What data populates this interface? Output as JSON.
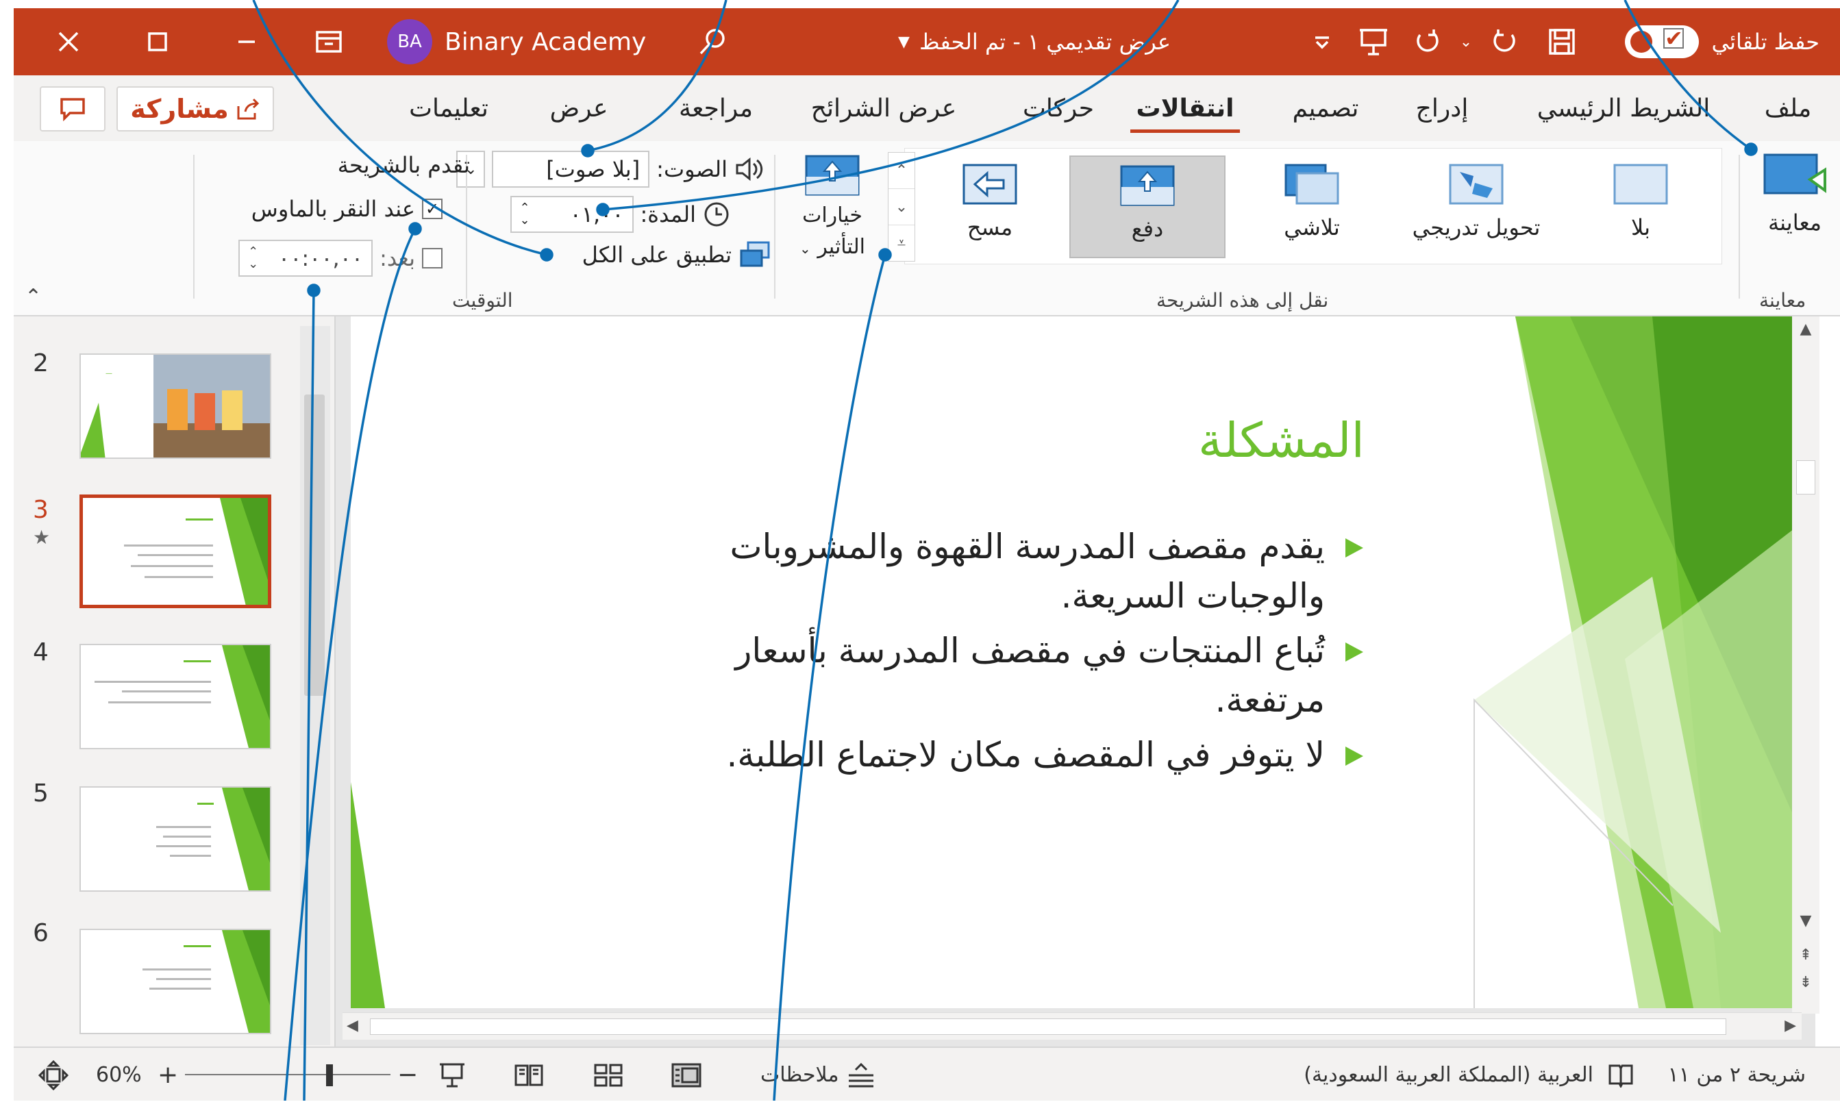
{
  "titlebar": {
    "account_initials": "BA",
    "account_name": "Binary Academy",
    "doc_title": "عرض تقديمي ١ - تم الحفظ",
    "autosave_label": "حفظ تلقائي"
  },
  "tabs": [
    "ملف",
    "الشريط الرئيسي",
    "إدراج",
    "تصميم",
    "انتقالات",
    "حركات",
    "عرض الشرائح",
    "مراجعة",
    "عرض",
    "تعليمات"
  ],
  "active_tab": "انتقالات",
  "share_label": "مشاركة",
  "ribbon": {
    "preview_label": "معاينة",
    "preview_group": "معاينة",
    "transitions": [
      "بلا",
      "تحويل تدريجي",
      "تلاشي",
      "دفع",
      "مسح"
    ],
    "selected_transition": "دفع",
    "transitions_group": "نقل إلى هذه الشريحة",
    "effect_options_line1": "خيارات",
    "effect_options_line2": "التأثير",
    "sound_label": "الصوت:",
    "sound_value": "[بلا صوت]",
    "duration_label": "المدة:",
    "duration_value": "٠١,٠٠",
    "apply_all_label": "تطبيق على الكل",
    "advance_label": "تقدم بالشريحة",
    "on_click_label": "عند النقر بالماوس",
    "on_click_checked": true,
    "after_label": "بعد:",
    "after_value": "٠٠:٠٠,٠٠",
    "timing_group": "التوقيت"
  },
  "thumbnails": [
    {
      "number": "2"
    },
    {
      "number": "3",
      "star": "★",
      "current": true
    },
    {
      "number": "4"
    },
    {
      "number": "5"
    },
    {
      "number": "6"
    }
  ],
  "slide": {
    "title": "المشكلة",
    "bullets": [
      "يقدم مقصف المدرسة القهوة والمشروبات والوجبات السريعة.",
      "تُباع المنتجات في مقصف المدرسة بأسعار مرتفعة.",
      "لا يتوفر في المقصف مكان لاجتماع الطلبة."
    ]
  },
  "statusbar": {
    "slide_info": "شريحة ٢ من ١١",
    "language": "العربية (المملكة العربية السعودية)",
    "notes_label": "ملاحظات",
    "zoom": "60%"
  },
  "colors": {
    "accent": "#c43e1c",
    "slide_green": "#6dbf2f",
    "callout_blue": "#0a6eb4"
  }
}
